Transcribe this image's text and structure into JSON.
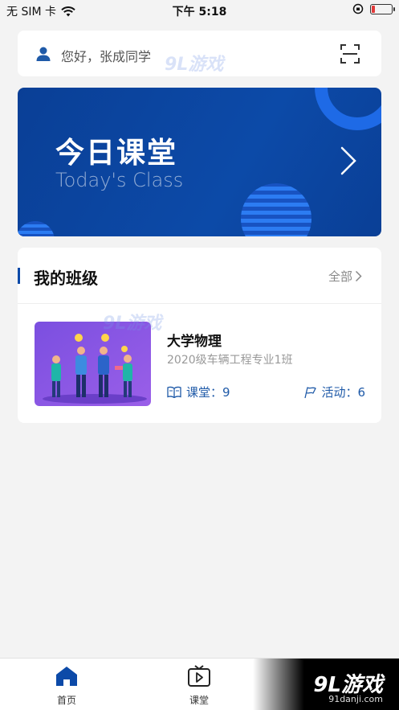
{
  "status_bar": {
    "carrier": "无 SIM 卡",
    "time": "下午 5:18",
    "battery_level": 0.15
  },
  "greeting": {
    "text": "您好，张成同学",
    "user_icon": "user-icon",
    "scan_icon": "scan-icon"
  },
  "banner": {
    "title": "今日课堂",
    "subtitle": "Today's Class",
    "arrow_icon": "chevron-right-icon"
  },
  "my_classes": {
    "title": "我的班级",
    "all_label": "全部",
    "items": [
      {
        "name": "大学物理",
        "class_name": "2020级车辆工程专业1班",
        "lessons_label": "课堂：9",
        "activities_label": "活动：6"
      }
    ]
  },
  "watermark": {
    "logo": "9L游戏",
    "site": "91danji.com"
  },
  "tab_bar": {
    "tabs": [
      {
        "label": "首页",
        "icon": "home-icon",
        "active": true
      },
      {
        "label": "课堂",
        "icon": "play-screen-icon",
        "active": false
      }
    ],
    "brand_logo": "9L游戏",
    "brand_site": "91danji.com"
  },
  "colors": {
    "primary": "#0c4aa8",
    "accent_text": "#1f5aa8",
    "background": "#f3f3f3"
  }
}
